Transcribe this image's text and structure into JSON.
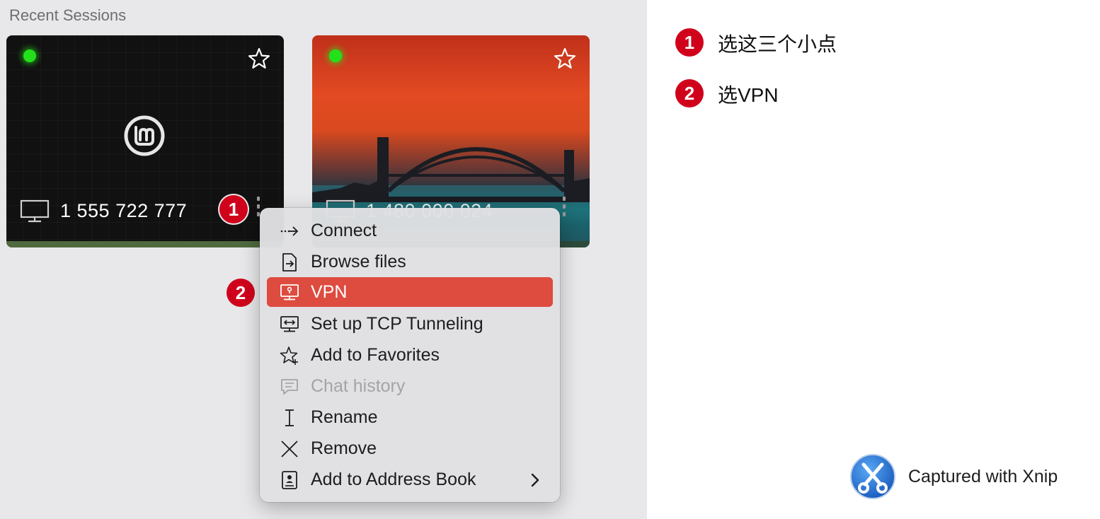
{
  "section_title": "Recent Sessions",
  "sessions": [
    {
      "id_label": "1 555 722 777"
    },
    {
      "id_label": "1 480 000 024"
    }
  ],
  "badges": {
    "one": "1",
    "two": "2"
  },
  "menu": {
    "items": [
      {
        "label": "Connect",
        "icon": "connect-arrow-icon"
      },
      {
        "label": "Browse files",
        "icon": "file-icon"
      },
      {
        "label": "VPN",
        "icon": "vpn-monitor-icon",
        "state": "highlighted"
      },
      {
        "label": "Set up TCP Tunneling",
        "icon": "tcp-tunnel-icon"
      },
      {
        "label": "Add to Favorites",
        "icon": "star-plus-icon"
      },
      {
        "label": "Chat history",
        "icon": "chat-icon",
        "state": "disabled"
      },
      {
        "label": "Rename",
        "icon": "text-cursor-icon"
      },
      {
        "label": "Remove",
        "icon": "close-x-icon"
      },
      {
        "label": "Add to Address Book",
        "icon": "address-book-icon",
        "submenu": true
      }
    ],
    "highlight_color": "#de4b3f"
  },
  "instructions": [
    {
      "num": "1",
      "text": "选这三个小点"
    },
    {
      "num": "2",
      "text": "选VPN"
    }
  ],
  "footer": {
    "text": "Captured with Xnip"
  },
  "colors": {
    "badge": "#d0021b",
    "online": "#22e11a"
  }
}
